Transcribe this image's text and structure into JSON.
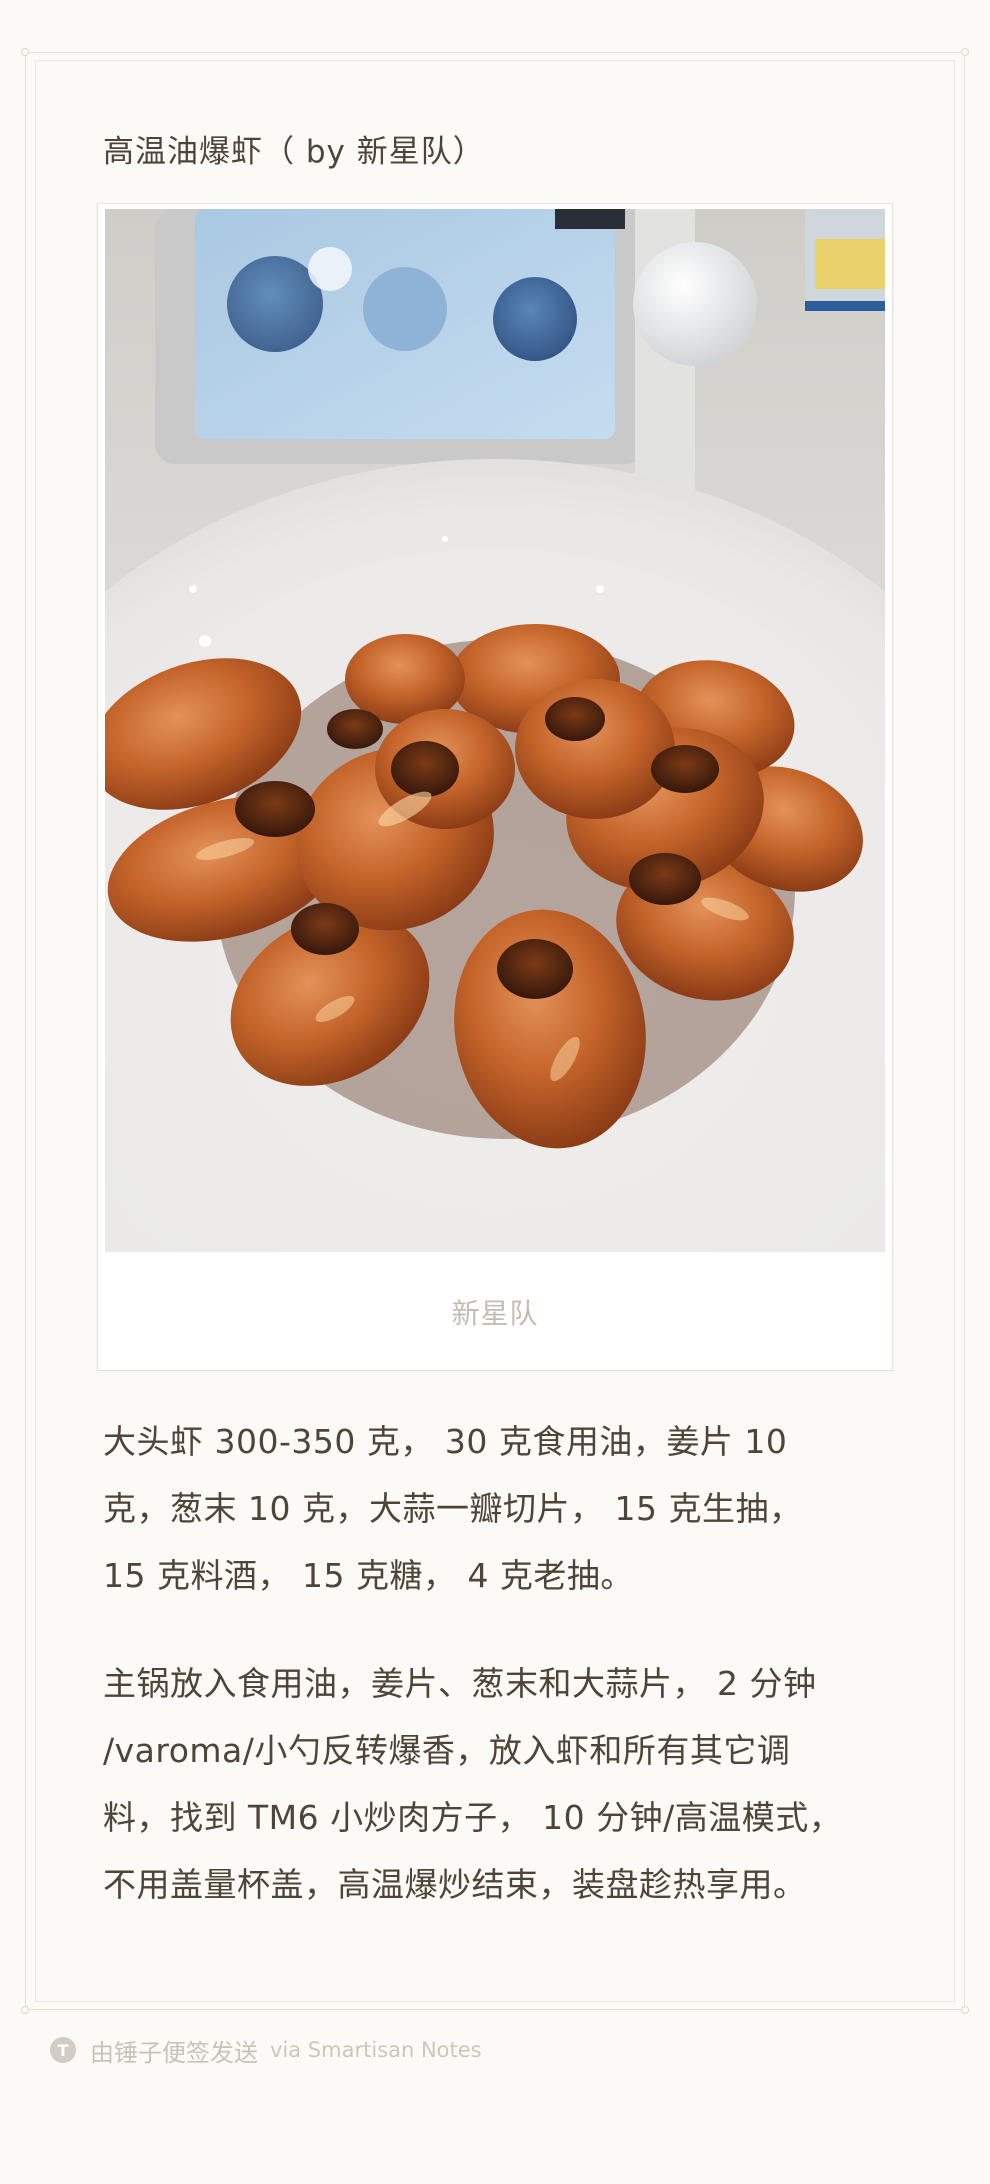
{
  "note": {
    "title": "高温油爆虾（ by 新星队）",
    "photo": {
      "alt": "glazed-shrimp-plate",
      "caption": "新星队"
    },
    "paragraphs": [
      {
        "lines": [
          "大头虾 300-350 克， 30 克食用油，姜片 10",
          "克，葱末 10 克，大蒜一瓣切片， 15 克生抽，",
          "15 克料酒， 15 克糖， 4 克老抽。"
        ]
      },
      {
        "lines": [
          "主锅放入食用油，姜片、葱末和大蒜片， 2 分钟",
          "/varoma/小勺反转爆香，放入虾和所有其它调",
          "料，找到 TM6 小炒肉方子， 10 分钟/高温模式，",
          "不用盖量杯盖，高温爆炒结束，装盘趁热享用。"
        ]
      }
    ]
  },
  "footer": {
    "badge_icon": "smartisan-t-icon",
    "badge_glyph": "T",
    "main_text": "由锤子便签发送",
    "sub_text": "via Smartisan Notes"
  },
  "colors": {
    "background": "#fcfaf6",
    "text": "#4f4438",
    "caption": "#c4bcb1",
    "footer": "#c9c2b8"
  }
}
